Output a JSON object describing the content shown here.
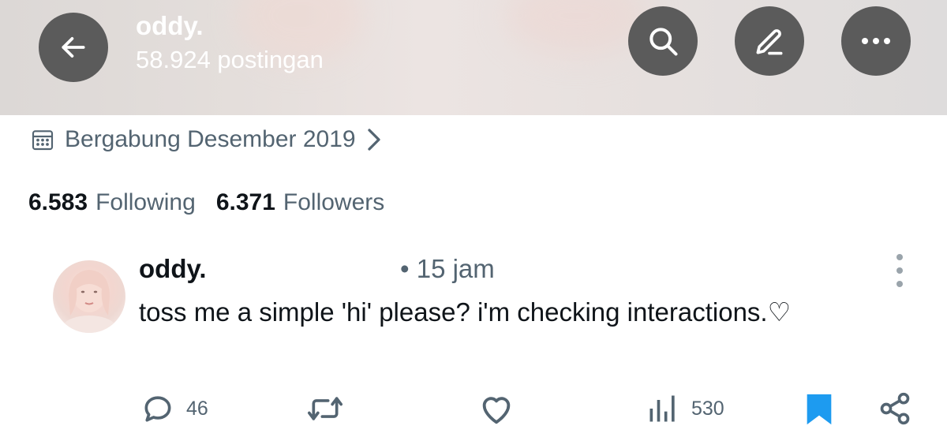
{
  "header": {
    "name": "oddy.",
    "posts_count": "58.924 postingan",
    "icons": [
      "back-arrow-icon",
      "search-icon",
      "edit-icon",
      "more-icon"
    ]
  },
  "profile": {
    "joined": "Bergabung Desember 2019",
    "following_count": "6.583",
    "following_label": "Following",
    "followers_count": "6.371",
    "followers_label": "Followers"
  },
  "tweet": {
    "name": "oddy.",
    "time": "• 15 jam",
    "text": "toss me a simple 'hi' please? i'm checking interactions.♡",
    "replies": "46",
    "views": "530",
    "bookmark_color": "#1d9bf0"
  },
  "colors": {
    "secondary_text": "#536471",
    "primary_text": "#0f1419",
    "header_button": "#5b5b5b",
    "accent": "#1d9bf0"
  }
}
